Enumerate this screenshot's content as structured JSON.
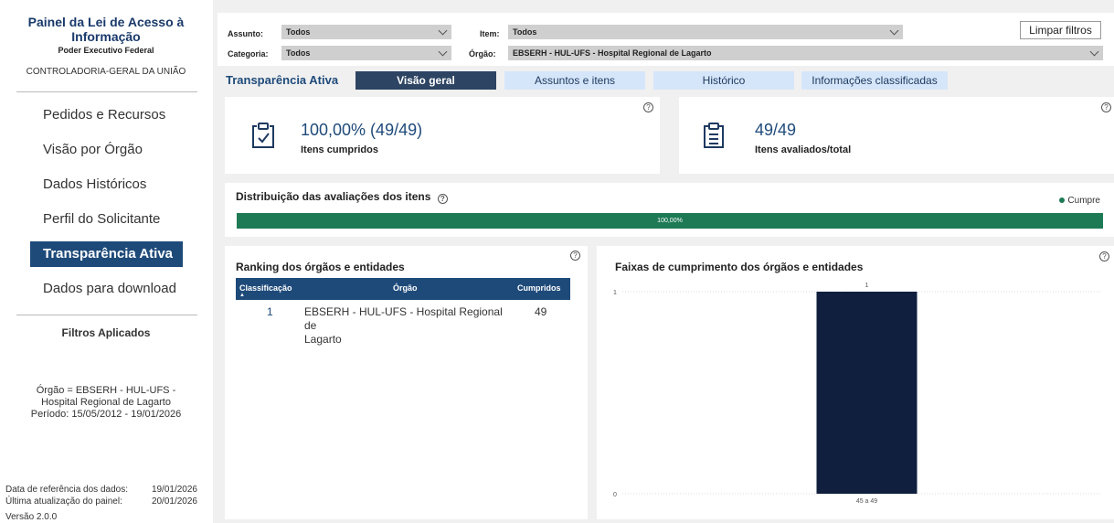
{
  "sidebar": {
    "title": "Painel da Lei de Acesso à Informação",
    "subtitle": "Poder Executivo Federal",
    "org": "CONTROLADORIA-GERAL DA UNIÃO",
    "nav": [
      {
        "label": "Pedidos e Recursos"
      },
      {
        "label": "Visão por Órgão"
      },
      {
        "label": "Dados Históricos"
      },
      {
        "label": "Perfil do Solicitante"
      },
      {
        "label": "Transparência Ativa"
      },
      {
        "label": "Dados para download"
      }
    ],
    "filters_title": "Filtros Aplicados",
    "filters_line1": "Órgão = EBSERH - HUL-UFS -",
    "filters_line2": "Hospital Regional de Lagarto",
    "filters_line3": "Período: 15/05/2012 - 19/01/2026",
    "ref_label": "Data de referência dos dados:",
    "ref_value": "19/01/2026",
    "update_label": "Última atualização do painel:",
    "update_value": "20/01/2026",
    "version": "Versão 2.0.0"
  },
  "filters": {
    "assunto_label": "Assunto:",
    "assunto_value": "Todos",
    "item_label": "Item:",
    "item_value": "Todos",
    "categoria_label": "Categoria:",
    "categoria_value": "Todos",
    "orgao_label": "Órgão:",
    "orgao_value": "EBSERH - HUL-UFS - Hospital Regional de Lagarto",
    "clear_label": "Limpar filtros"
  },
  "tabs": {
    "title": "Transparência Ativa",
    "items": [
      {
        "label": "Visão geral"
      },
      {
        "label": "Assuntos e itens"
      },
      {
        "label": "Histórico"
      },
      {
        "label": "Informações classificadas"
      }
    ]
  },
  "kpi": {
    "cumpridos_value": "100,00% (49/49)",
    "cumpridos_label": "Itens cumpridos",
    "avaliados_value": "49/49",
    "avaliados_label": "Itens avaliados/total"
  },
  "distribution": {
    "title": "Distribuição das avaliações dos itens",
    "legend": "Cumpre",
    "bar_label": "100,00%",
    "bar_fraction": 1.0,
    "color": "#1d7a55"
  },
  "ranking": {
    "title": "Ranking dos órgãos e entidades",
    "col_class": "Classificação",
    "col_orgao": "Órgão",
    "col_cumpridos": "Cumpridos",
    "rows": [
      {
        "rank": "1",
        "orgao_line1": "EBSERH - HUL-UFS - Hospital Regional de",
        "orgao_line2": "Lagarto",
        "cumpridos": "49"
      }
    ]
  },
  "chart_data": {
    "type": "bar",
    "title": "Faixas de cumprimento dos órgãos e entidades",
    "categories": [
      "45 a 49"
    ],
    "values": [
      1
    ],
    "ylim": [
      0,
      1
    ],
    "y_ticks": [
      "0",
      "1"
    ],
    "data_labels": [
      "1"
    ],
    "grid": true,
    "color": "#0f1f3d"
  }
}
